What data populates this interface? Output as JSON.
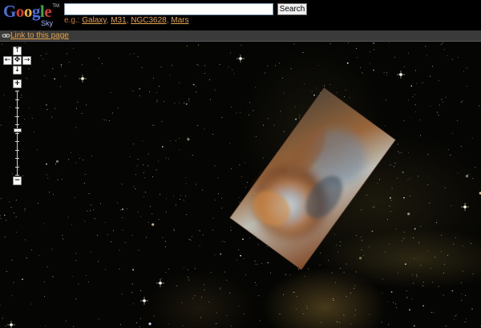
{
  "header": {
    "logo_letters": [
      {
        "ch": "G",
        "color": "#4a6fe3"
      },
      {
        "ch": "o",
        "color": "#d93a2b"
      },
      {
        "ch": "o",
        "color": "#f2b52b"
      },
      {
        "ch": "g",
        "color": "#4a6fe3"
      },
      {
        "ch": "l",
        "color": "#3aa845"
      },
      {
        "ch": "e",
        "color": "#d93a2b"
      }
    ],
    "logo_sub": "Sky",
    "logo_tm": "TM",
    "search_value": "",
    "search_button": "Search",
    "examples_prefix": "e.g.:",
    "examples": [
      "Galaxy",
      "M31",
      "NGC3628",
      "Mars"
    ]
  },
  "linkbar": {
    "link_icon": "chain-link-icon",
    "link_text": "Link to this page"
  },
  "nav": {
    "pan_up": "↑",
    "pan_left": "←",
    "pan_center": "✥",
    "pan_right": "→",
    "pan_down": "↓",
    "zoom_in": "+",
    "zoom_out": "−",
    "zoom_level_fraction": 0.47
  },
  "colors": {
    "link": "#e4a44a",
    "background": "#000000",
    "linkbar": "#3a3a3a"
  }
}
